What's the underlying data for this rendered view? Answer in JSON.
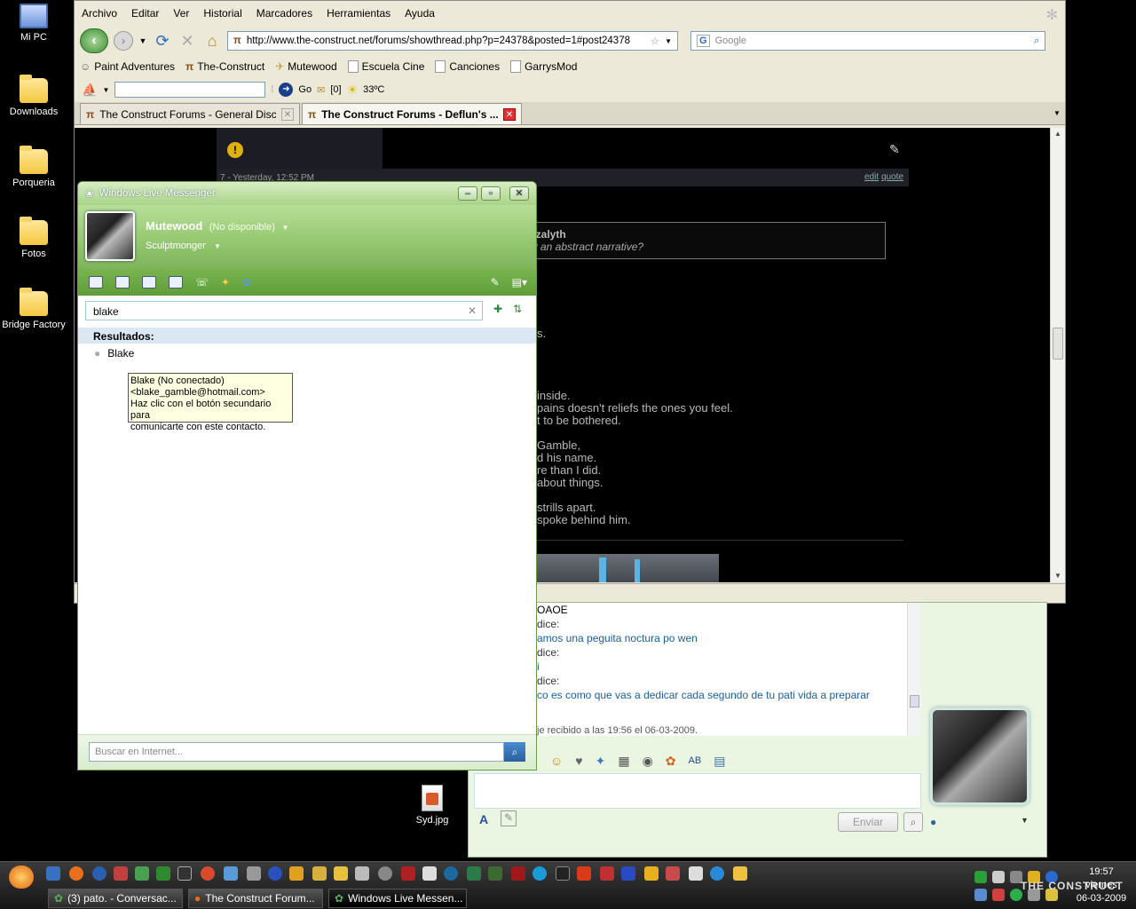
{
  "desktop": {
    "icons": [
      {
        "label": "Mi PC"
      },
      {
        "label": "Downloads"
      },
      {
        "label": "Porqueria"
      },
      {
        "label": "Fotos"
      },
      {
        "label": "Bridge Factory"
      },
      {
        "label": "Syd.jpg"
      }
    ]
  },
  "firefox": {
    "menu": [
      "Archivo",
      "Editar",
      "Ver",
      "Historial",
      "Marcadores",
      "Herramientas",
      "Ayuda"
    ],
    "url": "http://www.the-construct.net/forums/showthread.php?p=24378&posted=1#post24378",
    "search_placeholder": "Google",
    "bookmarks": [
      "Paint Adventures",
      "The-Construct",
      "Mutewood",
      "Escuela Cine",
      "Canciones",
      "GarrysMod"
    ],
    "ext": {
      "go": "Go",
      "count": "[0]",
      "temp": "33ºC"
    },
    "tabs": [
      {
        "label": "The Construct Forums - General Discus..."
      },
      {
        "label": "The Construct Forums - Deflun's ..."
      }
    ],
    "page": {
      "post_meta": "7 - Yesterday, 12:52 PM",
      "edit": "edit",
      "quote": "quote",
      "quote_author": "ezalyth",
      "quote_text": "ly an abstract narrative?",
      "lines": [
        "s.",
        "inside.",
        "pains doesn't reliefs the ones you feel.",
        "t to be bothered.",
        "Gamble,",
        "d his name.",
        "re than I did.",
        "about things.",
        "strills apart.",
        "spoke behind him."
      ]
    }
  },
  "conversation": {
    "lines": [
      {
        "text": "OAOE",
        "color": "#000000"
      },
      {
        "text": "dice:",
        "color": "#333333"
      },
      {
        "text": "amos una peguita noctura po wen",
        "color": "#1a5fa0"
      },
      {
        "text": "dice:",
        "color": "#333333"
      },
      {
        "text": "i",
        "color": "#1a5fa0"
      },
      {
        "text": "dice:",
        "color": "#333333"
      },
      {
        "text": "co es como que vas a dedicar cada segundo de tu pati vida a preparar",
        "color": "#1a5fa0"
      }
    ],
    "received": "je recibido a las 19:56 el 06-03-2009.",
    "send_label": "Enviar"
  },
  "messenger": {
    "title": "Windows Live Messenger",
    "user": {
      "name": "Mutewood",
      "status": "(No disponible)",
      "message": "Sculptmonger"
    },
    "search_value": "blake",
    "results_label": "Resultados:",
    "contacts": [
      {
        "name": "Blake"
      }
    ],
    "tooltip": {
      "line1": "Blake (No conectado)",
      "line2": "<blake_gamble@hotmail.com>",
      "line3": "Haz clic con el botón secundario para",
      "line4": "comunicarte con este contacto."
    },
    "web_search_placeholder": "Buscar en Internet..."
  },
  "taskbar": {
    "tasks": [
      {
        "label": "(3) pato. - Conversac..."
      },
      {
        "label": "The Construct Forum..."
      },
      {
        "label": "Windows Live Messen..."
      }
    ],
    "clock": {
      "time": "19:57",
      "day": "viernes",
      "date": "06-03-2009"
    },
    "watermark": "THE CONSTRUCT"
  }
}
